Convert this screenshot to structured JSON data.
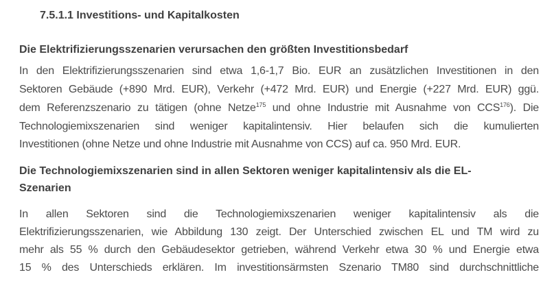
{
  "section_heading": "7.5.1.1  Investitions- und Kapitalkosten",
  "subheading1": "Die Elektrifizierungsszenarien verursachen den größten Investitionsbedarf",
  "para1": {
    "line1": "In den Elektrifizierungsszenarien sind etwa 1,6-1,7 Bio. EUR an zusätzlichen Investitionen in den",
    "line2": "Sektoren Gebäude (+890 Mrd. EUR), Verkehr (+472 Mrd. EUR) und Energie (+227 Mrd. EUR) ggü.",
    "line3_a": "dem Referenzszenario zu tätigen (ohne Netze",
    "line3_sup1": "175",
    "line3_b": " und ohne Industrie mit Ausnahme von CCS",
    "line3_sup2": "176",
    "line3_c": "). Die",
    "line4": "Technologiemixszenarien sind weniger kapitalintensiv. Hier belaufen sich die kumulierten",
    "line5": "Investitionen (ohne Netze und ohne Industrie mit Ausnahme von CCS) auf ca. 950 Mrd. EUR."
  },
  "subheading2": {
    "line1": "Die Technologiemixszenarien sind in allen Sektoren weniger kapitalintensiv als die EL-",
    "line2": "Szenarien"
  },
  "para2": {
    "line1": "In allen Sektoren sind die Technologiemixszenarien weniger kapitalintensiv als die",
    "line2": "Elektrifizierungsszenarien, wie Abbildung 130 zeigt. Der Unterschied zwischen EL und TM wird zu",
    "line3": "mehr als 55 % durch den Gebäudesektor getrieben, während Verkehr etwa 30 % und Energie etwa",
    "line4": "15 % des Unterschieds erklären. Im investitionsärmsten Szenario TM80 sind durchschnittliche"
  }
}
